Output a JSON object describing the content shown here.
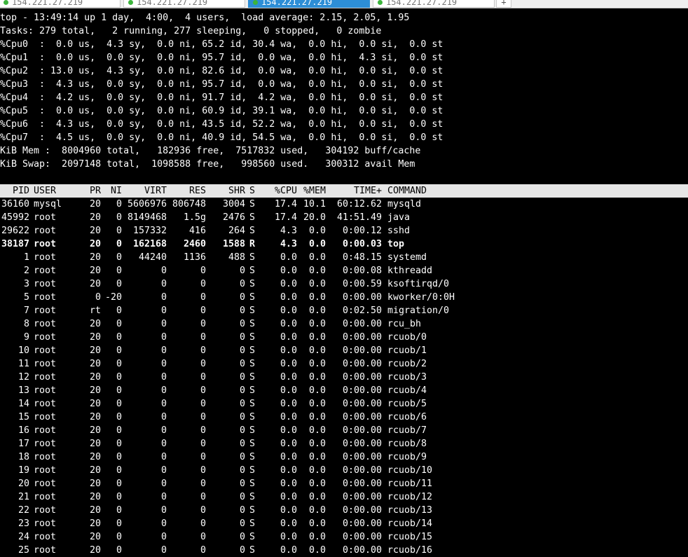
{
  "tabs": [
    {
      "label": "154.221.27.219",
      "active": false
    },
    {
      "label": "154.221.27.219",
      "active": false
    },
    {
      "label": "154.221.27.219",
      "active": true
    },
    {
      "label": "154.221.27.219",
      "active": false
    }
  ],
  "tab_add": "+",
  "summary": {
    "top": "top - 13:49:14 up 1 day,  4:00,  4 users,  load average: 2.15, 2.05, 1.95",
    "tasks": "Tasks: 279 total,   2 running, 277 sleeping,   0 stopped,   0 zombie",
    "cpus": [
      "%Cpu0  :  0.0 us,  4.3 sy,  0.0 ni, 65.2 id, 30.4 wa,  0.0 hi,  0.0 si,  0.0 st",
      "%Cpu1  :  0.0 us,  0.0 sy,  0.0 ni, 95.7 id,  0.0 wa,  0.0 hi,  4.3 si,  0.0 st",
      "%Cpu2  : 13.0 us,  4.3 sy,  0.0 ni, 82.6 id,  0.0 wa,  0.0 hi,  0.0 si,  0.0 st",
      "%Cpu3  :  4.3 us,  0.0 sy,  0.0 ni, 95.7 id,  0.0 wa,  0.0 hi,  0.0 si,  0.0 st",
      "%Cpu4  :  4.2 us,  0.0 sy,  0.0 ni, 91.7 id,  4.2 wa,  0.0 hi,  0.0 si,  0.0 st",
      "%Cpu5  :  0.0 us,  0.0 sy,  0.0 ni, 60.9 id, 39.1 wa,  0.0 hi,  0.0 si,  0.0 st",
      "%Cpu6  :  4.3 us,  0.0 sy,  0.0 ni, 43.5 id, 52.2 wa,  0.0 hi,  0.0 si,  0.0 st",
      "%Cpu7  :  4.5 us,  0.0 sy,  0.0 ni, 40.9 id, 54.5 wa,  0.0 hi,  0.0 si,  0.0 st"
    ],
    "mem": "KiB Mem :  8004960 total,   182936 free,  7517832 used,   304192 buff/cache",
    "swap": "KiB Swap:  2097148 total,  1098588 free,   998560 used.   300312 avail Mem"
  },
  "columns": [
    "PID",
    "USER",
    "PR",
    "NI",
    "VIRT",
    "RES",
    "SHR",
    "S",
    "%CPU",
    "%MEM",
    "TIME+",
    "COMMAND"
  ],
  "processes": [
    {
      "pid": "36160",
      "user": "mysql",
      "pr": "20",
      "ni": "0",
      "virt": "5606976",
      "res": "806748",
      "shr": "3004",
      "s": "S",
      "cpu": "17.4",
      "mem": "10.1",
      "time": "60:12.62",
      "cmd": "mysqld"
    },
    {
      "pid": "45992",
      "user": "root",
      "pr": "20",
      "ni": "0",
      "virt": "8149468",
      "res": "1.5g",
      "shr": "2476",
      "s": "S",
      "cpu": "17.4",
      "mem": "20.0",
      "time": "41:51.49",
      "cmd": "java"
    },
    {
      "pid": "29622",
      "user": "root",
      "pr": "20",
      "ni": "0",
      "virt": "157332",
      "res": "416",
      "shr": "264",
      "s": "S",
      "cpu": "4.3",
      "mem": "0.0",
      "time": "0:00.12",
      "cmd": "sshd"
    },
    {
      "pid": "38187",
      "user": "root",
      "pr": "20",
      "ni": "0",
      "virt": "162168",
      "res": "2460",
      "shr": "1588",
      "s": "R",
      "cpu": "4.3",
      "mem": "0.0",
      "time": "0:00.03",
      "cmd": "top",
      "bold": true
    },
    {
      "pid": "1",
      "user": "root",
      "pr": "20",
      "ni": "0",
      "virt": "44240",
      "res": "1136",
      "shr": "488",
      "s": "S",
      "cpu": "0.0",
      "mem": "0.0",
      "time": "0:48.15",
      "cmd": "systemd"
    },
    {
      "pid": "2",
      "user": "root",
      "pr": "20",
      "ni": "0",
      "virt": "0",
      "res": "0",
      "shr": "0",
      "s": "S",
      "cpu": "0.0",
      "mem": "0.0",
      "time": "0:00.08",
      "cmd": "kthreadd"
    },
    {
      "pid": "3",
      "user": "root",
      "pr": "20",
      "ni": "0",
      "virt": "0",
      "res": "0",
      "shr": "0",
      "s": "S",
      "cpu": "0.0",
      "mem": "0.0",
      "time": "0:00.59",
      "cmd": "ksoftirqd/0"
    },
    {
      "pid": "5",
      "user": "root",
      "pr": "0",
      "ni": "-20",
      "virt": "0",
      "res": "0",
      "shr": "0",
      "s": "S",
      "cpu": "0.0",
      "mem": "0.0",
      "time": "0:00.00",
      "cmd": "kworker/0:0H"
    },
    {
      "pid": "7",
      "user": "root",
      "pr": "rt",
      "ni": "0",
      "virt": "0",
      "res": "0",
      "shr": "0",
      "s": "S",
      "cpu": "0.0",
      "mem": "0.0",
      "time": "0:02.50",
      "cmd": "migration/0"
    },
    {
      "pid": "8",
      "user": "root",
      "pr": "20",
      "ni": "0",
      "virt": "0",
      "res": "0",
      "shr": "0",
      "s": "S",
      "cpu": "0.0",
      "mem": "0.0",
      "time": "0:00.00",
      "cmd": "rcu_bh"
    },
    {
      "pid": "9",
      "user": "root",
      "pr": "20",
      "ni": "0",
      "virt": "0",
      "res": "0",
      "shr": "0",
      "s": "S",
      "cpu": "0.0",
      "mem": "0.0",
      "time": "0:00.00",
      "cmd": "rcuob/0"
    },
    {
      "pid": "10",
      "user": "root",
      "pr": "20",
      "ni": "0",
      "virt": "0",
      "res": "0",
      "shr": "0",
      "s": "S",
      "cpu": "0.0",
      "mem": "0.0",
      "time": "0:00.00",
      "cmd": "rcuob/1"
    },
    {
      "pid": "11",
      "user": "root",
      "pr": "20",
      "ni": "0",
      "virt": "0",
      "res": "0",
      "shr": "0",
      "s": "S",
      "cpu": "0.0",
      "mem": "0.0",
      "time": "0:00.00",
      "cmd": "rcuob/2"
    },
    {
      "pid": "12",
      "user": "root",
      "pr": "20",
      "ni": "0",
      "virt": "0",
      "res": "0",
      "shr": "0",
      "s": "S",
      "cpu": "0.0",
      "mem": "0.0",
      "time": "0:00.00",
      "cmd": "rcuob/3"
    },
    {
      "pid": "13",
      "user": "root",
      "pr": "20",
      "ni": "0",
      "virt": "0",
      "res": "0",
      "shr": "0",
      "s": "S",
      "cpu": "0.0",
      "mem": "0.0",
      "time": "0:00.00",
      "cmd": "rcuob/4"
    },
    {
      "pid": "14",
      "user": "root",
      "pr": "20",
      "ni": "0",
      "virt": "0",
      "res": "0",
      "shr": "0",
      "s": "S",
      "cpu": "0.0",
      "mem": "0.0",
      "time": "0:00.00",
      "cmd": "rcuob/5"
    },
    {
      "pid": "15",
      "user": "root",
      "pr": "20",
      "ni": "0",
      "virt": "0",
      "res": "0",
      "shr": "0",
      "s": "S",
      "cpu": "0.0",
      "mem": "0.0",
      "time": "0:00.00",
      "cmd": "rcuob/6"
    },
    {
      "pid": "16",
      "user": "root",
      "pr": "20",
      "ni": "0",
      "virt": "0",
      "res": "0",
      "shr": "0",
      "s": "S",
      "cpu": "0.0",
      "mem": "0.0",
      "time": "0:00.00",
      "cmd": "rcuob/7"
    },
    {
      "pid": "17",
      "user": "root",
      "pr": "20",
      "ni": "0",
      "virt": "0",
      "res": "0",
      "shr": "0",
      "s": "S",
      "cpu": "0.0",
      "mem": "0.0",
      "time": "0:00.00",
      "cmd": "rcuob/8"
    },
    {
      "pid": "18",
      "user": "root",
      "pr": "20",
      "ni": "0",
      "virt": "0",
      "res": "0",
      "shr": "0",
      "s": "S",
      "cpu": "0.0",
      "mem": "0.0",
      "time": "0:00.00",
      "cmd": "rcuob/9"
    },
    {
      "pid": "19",
      "user": "root",
      "pr": "20",
      "ni": "0",
      "virt": "0",
      "res": "0",
      "shr": "0",
      "s": "S",
      "cpu": "0.0",
      "mem": "0.0",
      "time": "0:00.00",
      "cmd": "rcuob/10"
    },
    {
      "pid": "20",
      "user": "root",
      "pr": "20",
      "ni": "0",
      "virt": "0",
      "res": "0",
      "shr": "0",
      "s": "S",
      "cpu": "0.0",
      "mem": "0.0",
      "time": "0:00.00",
      "cmd": "rcuob/11"
    },
    {
      "pid": "21",
      "user": "root",
      "pr": "20",
      "ni": "0",
      "virt": "0",
      "res": "0",
      "shr": "0",
      "s": "S",
      "cpu": "0.0",
      "mem": "0.0",
      "time": "0:00.00",
      "cmd": "rcuob/12"
    },
    {
      "pid": "22",
      "user": "root",
      "pr": "20",
      "ni": "0",
      "virt": "0",
      "res": "0",
      "shr": "0",
      "s": "S",
      "cpu": "0.0",
      "mem": "0.0",
      "time": "0:00.00",
      "cmd": "rcuob/13"
    },
    {
      "pid": "23",
      "user": "root",
      "pr": "20",
      "ni": "0",
      "virt": "0",
      "res": "0",
      "shr": "0",
      "s": "S",
      "cpu": "0.0",
      "mem": "0.0",
      "time": "0:00.00",
      "cmd": "rcuob/14"
    },
    {
      "pid": "24",
      "user": "root",
      "pr": "20",
      "ni": "0",
      "virt": "0",
      "res": "0",
      "shr": "0",
      "s": "S",
      "cpu": "0.0",
      "mem": "0.0",
      "time": "0:00.00",
      "cmd": "rcuob/15"
    },
    {
      "pid": "25",
      "user": "root",
      "pr": "20",
      "ni": "0",
      "virt": "0",
      "res": "0",
      "shr": "0",
      "s": "S",
      "cpu": "0.0",
      "mem": "0.0",
      "time": "0:00.00",
      "cmd": "rcuob/16"
    }
  ]
}
